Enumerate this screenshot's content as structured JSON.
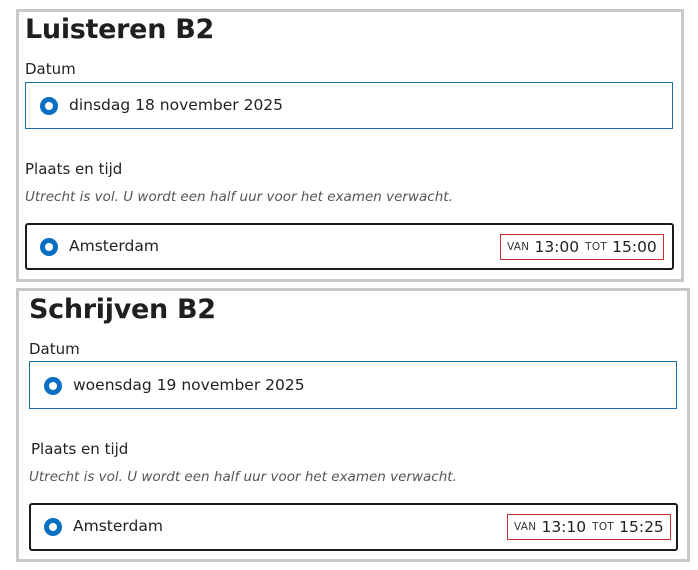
{
  "exams": [
    {
      "title": "Luisteren B2",
      "date_label": "Datum",
      "date_option": "dinsdag 18 november 2025",
      "place_label": "Plaats en tijd",
      "note": "Utrecht is vol. U wordt een half uur voor het examen verwacht.",
      "place_option": "Amsterdam",
      "from_label": "VAN",
      "from_time": "13:00",
      "to_label": "TOT",
      "to_time": "15:00"
    },
    {
      "title": "Schrijven B2",
      "date_label": "Datum",
      "date_option": "woensdag 19 november 2025",
      "place_label": "Plaats en tijd",
      "note": "Utrecht is vol. U wordt een half uur voor het examen verwacht.",
      "place_option": "Amsterdam",
      "from_label": "VAN",
      "from_time": "13:10",
      "to_label": "TOT",
      "to_time": "15:25"
    }
  ],
  "colors": {
    "radio": "#0a6fc2",
    "date_border": "#1a6fa8",
    "time_highlight": "#c9302c",
    "panel_border": "#c8c8c8"
  }
}
